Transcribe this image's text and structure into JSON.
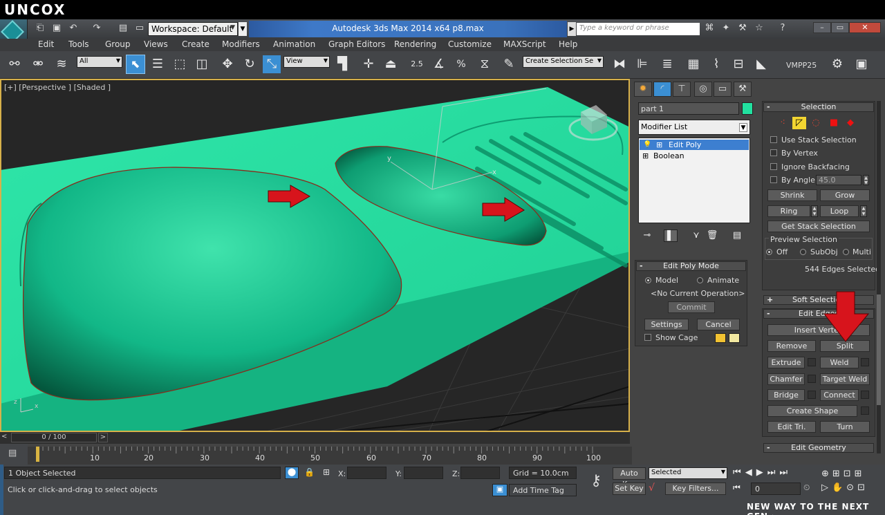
{
  "brand": "UNCOX",
  "title_bar": {
    "workspace": "Workspace: Default",
    "title": "Autodesk 3ds Max  2014 x64      p8.max",
    "search_placeholder": "Type a keyword or phrase"
  },
  "menu": [
    "Edit",
    "Tools",
    "Group",
    "Views",
    "Create",
    "Modifiers",
    "Animation",
    "Graph Editors",
    "Rendering",
    "Customize",
    "MAXScript",
    "Help"
  ],
  "toolbar": {
    "filter": "All",
    "ref_coord": "View",
    "snap_value": "2.5",
    "selection_set": "Create Selection Se",
    "vmpp": "VMPP25"
  },
  "viewport": {
    "label": "[+] [Perspective ] [Shaded ]",
    "axes": {
      "x": "x",
      "y": "y",
      "z": "z"
    }
  },
  "command_panel": {
    "object_name": "part 1",
    "object_color": "#22e1a0",
    "modifier_list": "Modifier List",
    "stack": [
      "Edit Poly",
      "Boolean"
    ],
    "edit_poly_mode": {
      "title": "Edit Poly Mode",
      "model": "Model",
      "animate": "Animate",
      "operation": "<No Current Operation>",
      "commit": "Commit",
      "settings": "Settings",
      "cancel": "Cancel",
      "show_cage": "Show Cage"
    },
    "selection": {
      "title": "Selection",
      "use_stack": "Use Stack Selection",
      "by_vertex": "By Vertex",
      "ignore_backfacing": "Ignore Backfacing",
      "by_angle": "By Angle:",
      "angle_value": "45.0",
      "shrink": "Shrink",
      "grow": "Grow",
      "ring": "Ring",
      "loop": "Loop",
      "get_stack": "Get Stack Selection",
      "preview": "Preview Selection",
      "off": "Off",
      "subobj": "SubObj",
      "multi": "Multi",
      "count": "544 Edges Selected"
    },
    "soft_selection": "Soft Selection",
    "edit_edges": {
      "title": "Edit Edges",
      "insert_vertex": "Insert Vertex",
      "remove": "Remove",
      "split": "Split",
      "extrude": "Extrude",
      "weld": "Weld",
      "chamfer": "Chamfer",
      "target_weld": "Target Weld",
      "bridge": "Bridge",
      "connect": "Connect",
      "create_shape": "Create Shape",
      "edit_tri": "Edit Tri.",
      "turn": "Turn"
    },
    "edit_geometry": "Edit Geometry"
  },
  "timeline": {
    "frame": "0 / 100",
    "ticks": [
      "0",
      "10",
      "20",
      "30",
      "40",
      "50",
      "60",
      "70",
      "80",
      "90",
      "100"
    ]
  },
  "status": {
    "selected": "1 Object Selected",
    "prompt": "Click or click-and-drag to select objects",
    "x_label": "X:",
    "y_label": "Y:",
    "z_label": "Z:",
    "grid": "Grid = 10.0cm",
    "add_time_tag": "Add Time Tag",
    "auto_key": "Auto Key",
    "set_key": "Set Key",
    "key_mode": "Selected",
    "key_filters": "Key Filters...",
    "frame_field": "0"
  },
  "footer": "NEW WAY TO THE NEXT GEN ›"
}
